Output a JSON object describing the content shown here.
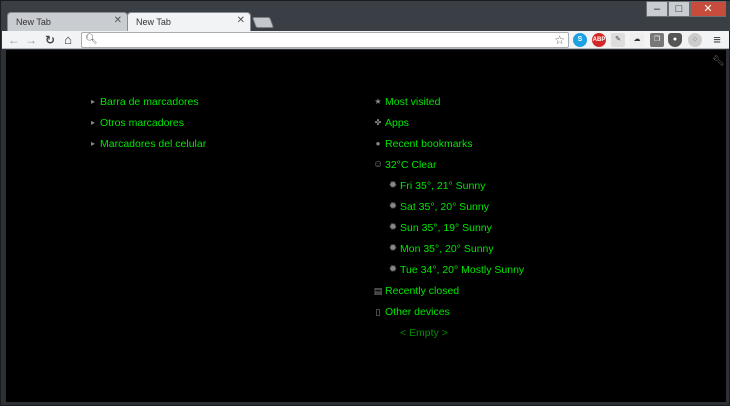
{
  "tabs": [
    {
      "title": "New Tab",
      "active": false
    },
    {
      "title": "New Tab",
      "active": true
    }
  ],
  "window_controls": {
    "minimize": "–",
    "maximize": "□",
    "close": "✕"
  },
  "toolbar": {
    "omnibox_value": "",
    "extensions": [
      {
        "name": "skype-icon",
        "glyph": "S"
      },
      {
        "name": "adblock-icon",
        "glyph": "ABP"
      },
      {
        "name": "extension-note-icon",
        "glyph": "✎"
      },
      {
        "name": "extension-weather-icon",
        "glyph": "☁"
      },
      {
        "name": "extension-pages-icon",
        "glyph": "❐"
      },
      {
        "name": "extension-shield-icon",
        "glyph": "●"
      },
      {
        "name": "extension-sync-icon",
        "glyph": "○"
      }
    ]
  },
  "bookmarks": [
    {
      "label": "Barra de marcadores"
    },
    {
      "label": "Otros marcadores"
    },
    {
      "label": "Marcadores del celular"
    }
  ],
  "sections": {
    "most_visited": "Most visited",
    "apps": "Apps",
    "recent_bookmarks": "Recent bookmarks",
    "weather_current": "32°C Clear",
    "forecast": [
      {
        "label": "Fri 35°, 21° Sunny"
      },
      {
        "label": "Sat 35°, 20° Sunny"
      },
      {
        "label": "Sun 35°, 19° Sunny"
      },
      {
        "label": "Mon 35°, 20° Sunny"
      },
      {
        "label": "Tue 34°, 20° Mostly Sunny"
      }
    ],
    "recently_closed": "Recently closed",
    "other_devices": "Other devices",
    "empty": "< Empty >"
  },
  "colors": {
    "link_text": "#00e600",
    "muted_text": "#008f00",
    "page_bg": "#000000"
  }
}
